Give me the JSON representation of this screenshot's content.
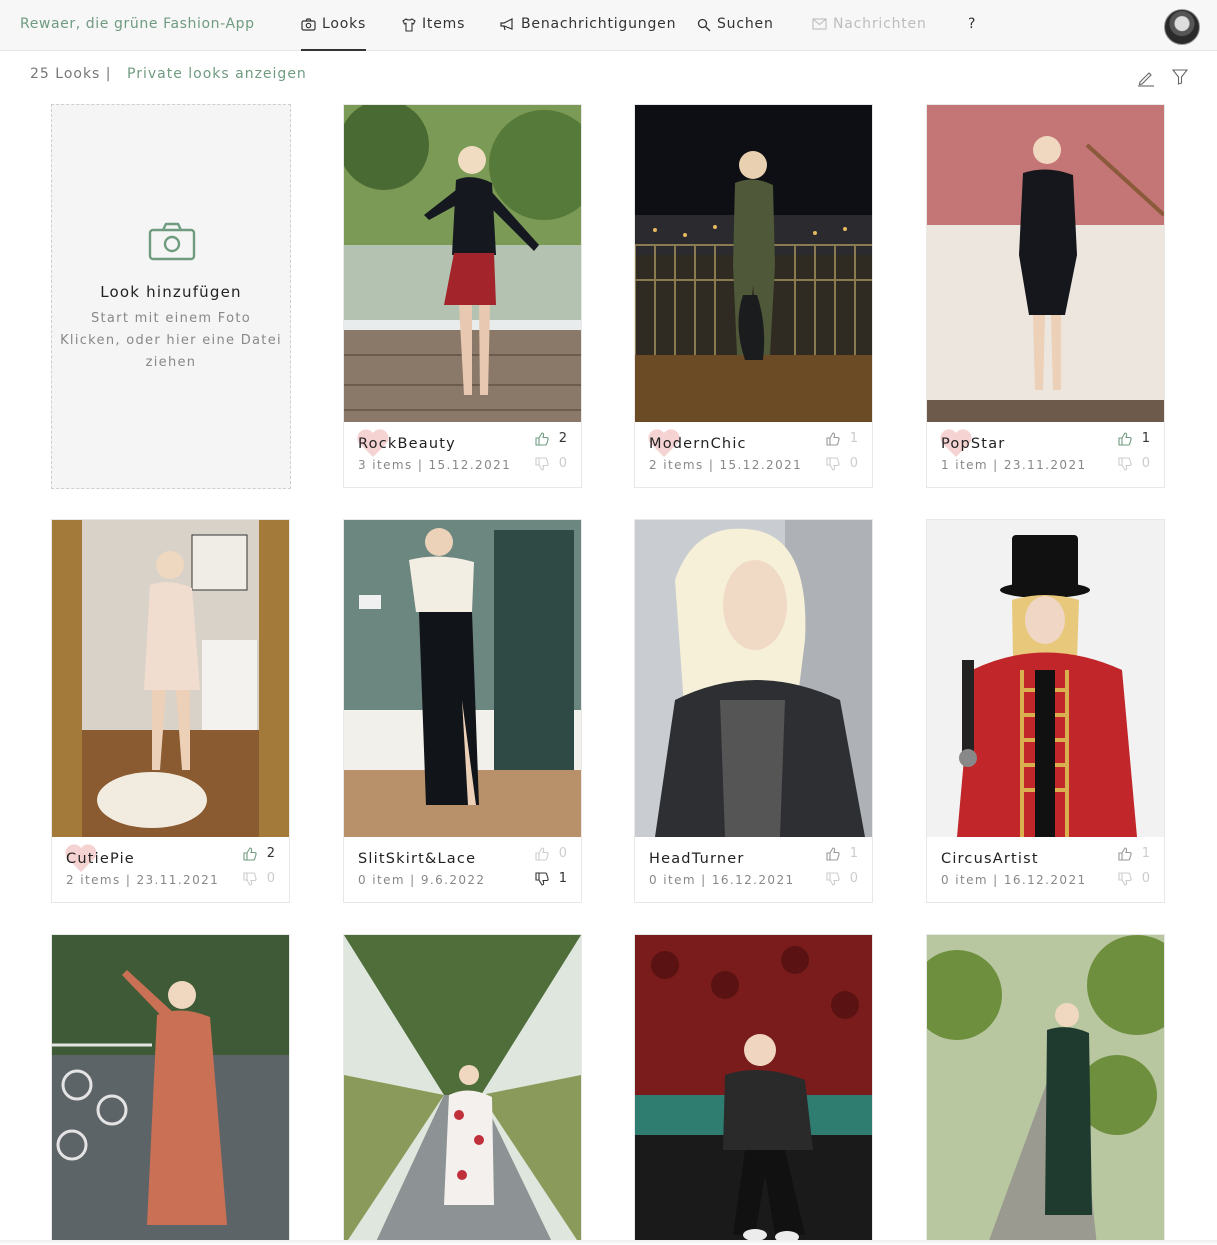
{
  "app": {
    "title": "Rewaer, die grüne Fashion-App"
  },
  "nav": {
    "looks": "Looks",
    "items": "Items",
    "notifications": "Benachrichtigungen",
    "search": "Suchen",
    "messages": "Nachrichten",
    "help": "?"
  },
  "subbar": {
    "count": "25 Looks |",
    "private": "Private looks anzeigen"
  },
  "add": {
    "title": "Look hinzufügen",
    "line1": "Start mit einem Foto",
    "line2": "Klicken, oder hier eine Datei",
    "line3": "ziehen"
  },
  "looks": [
    {
      "name": "RockBeauty",
      "meta": "3 items | 15.12.2021",
      "up": "2",
      "down": "0",
      "favorite": true
    },
    {
      "name": "ModernChic",
      "meta": "2 items | 15.12.2021",
      "up": "1",
      "down": "0",
      "favorite": true
    },
    {
      "name": "PopStar",
      "meta": "1 item | 23.11.2021",
      "up": "1",
      "down": "0",
      "favorite": true
    },
    {
      "name": "CutiePie",
      "meta": "2 items | 23.11.2021",
      "up": "2",
      "down": "0",
      "favorite": true
    },
    {
      "name": "SlitSkirt&Lace",
      "meta": "0 item | 9.6.2022",
      "up": "0",
      "down": "1",
      "favorite": false
    },
    {
      "name": "HeadTurner",
      "meta": "0 item | 16.12.2021",
      "up": "1",
      "down": "0",
      "favorite": false
    },
    {
      "name": "CircusArtist",
      "meta": "0 item | 16.12.2021",
      "up": "1",
      "down": "0",
      "favorite": false
    }
  ],
  "colors": {
    "accent": "#6f9b80",
    "heart": "#f6d3d3"
  }
}
